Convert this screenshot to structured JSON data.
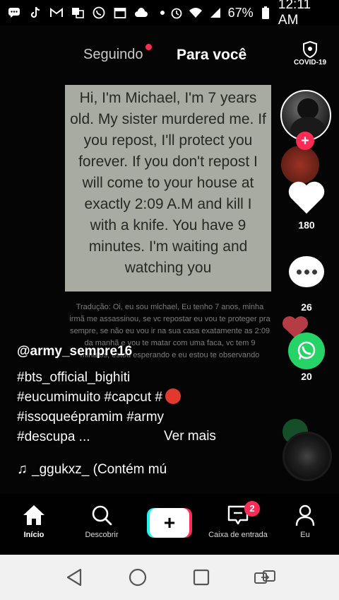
{
  "status_bar": {
    "battery": "67%",
    "time": "12:11 AM"
  },
  "video": {
    "note_text": "Hi, I'm Michael, I'm 7 years old. My sister murdered me. If you repost, I'll protect you forever. If you don't repost I will come to your house at exactly 2:09 A.M and kill I with a knife. You have 9 minutes. I'm waiting and watching you",
    "translation_text": "Tradução: Oi, eu sou michael, Eu tenho 7 anos, minha irmã me assassinou, se vc repostar eu vou te proteger pra sempre, se não eu vou ir na sua casa exatamente as 2:09 da manhã e vou te matar com uma faca, vc tem 9 minutos, estou esperando e eu estou te observando"
  },
  "top_nav": {
    "following": "Seguindo",
    "for_you": "Para você",
    "covid_label": "COVID-19"
  },
  "rail": {
    "likes": "180",
    "comments": "26",
    "shares": "20"
  },
  "caption": {
    "username": "@army_sempre16",
    "line1": "#bts_official_bighiti",
    "line2": "#eucumimuito #capcut #",
    "line3": "#issoqueépramim #army",
    "line4": "#descupa ...",
    "see_more": "Ver mais",
    "music": "_ggukxz_ (Contém mú"
  },
  "tabbar": {
    "home": "Início",
    "discover": "Descobrir",
    "create": "+",
    "inbox": "Caixa de entrada",
    "inbox_badge": "2",
    "profile": "Eu"
  },
  "colors": {
    "accent": "#fe2c55",
    "cyan": "#25f4ee",
    "whatsapp": "#25d366"
  }
}
